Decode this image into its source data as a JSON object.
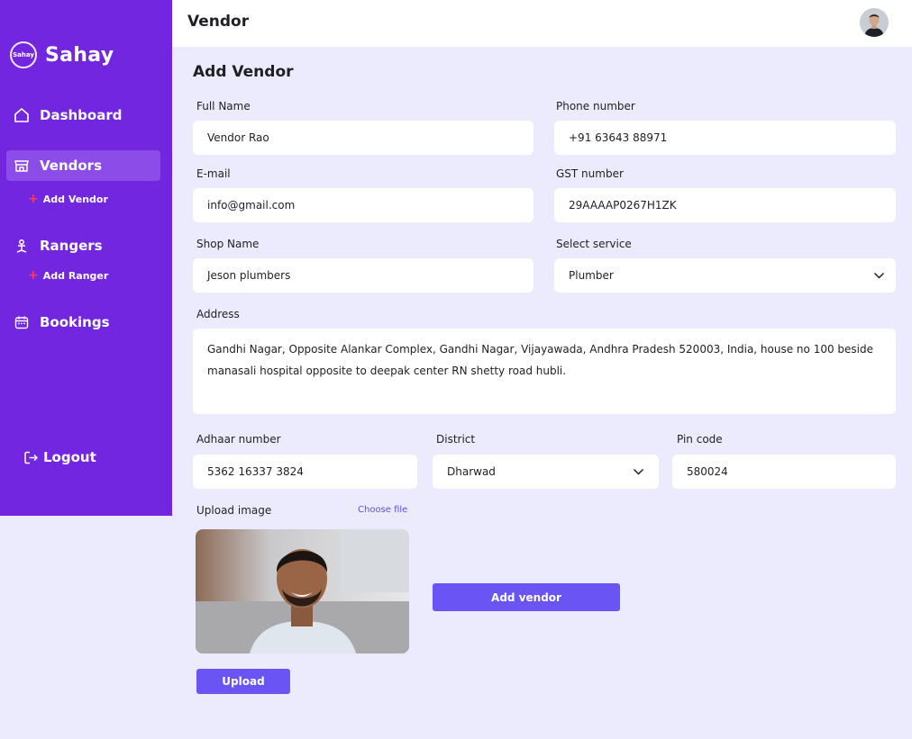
{
  "app": {
    "logo_badge": "Sahay",
    "name": "Sahay"
  },
  "sidebar": {
    "items": [
      {
        "label": "Dashboard",
        "icon": "home-icon"
      },
      {
        "label": "Vendors",
        "icon": "store-icon"
      },
      {
        "label": "Rangers",
        "icon": "ranger-icon"
      },
      {
        "label": "Bookings",
        "icon": "calendar-icon"
      }
    ],
    "sub_vendors": "Add Vendor",
    "sub_rangers": "Add Ranger",
    "logout": "Logout"
  },
  "header": {
    "title": "Vendor"
  },
  "form": {
    "title": "Add Vendor",
    "full_name": {
      "label": "Full Name",
      "value": "Vendor Rao"
    },
    "phone": {
      "label": "Phone number",
      "value": "+91 63643 88971"
    },
    "email": {
      "label": "E-mail",
      "value": "info@gmail.com"
    },
    "gst": {
      "label": "GST number",
      "value": "29AAAAP0267H1ZK"
    },
    "shop": {
      "label": "Shop Name",
      "value": "Jeson plumbers"
    },
    "service": {
      "label": "Select service",
      "value": "Plumber"
    },
    "address": {
      "label": "Address",
      "value": "Gandhi Nagar, Opposite Alankar Complex, Gandhi Nagar, Vijayawada, Andhra Pradesh 520003, India, house no 100 beside manasali hospital opposite to deepak center RN shetty road hubli."
    },
    "aadhaar": {
      "label": "Adhaar number",
      "value": "5362 16337 3824"
    },
    "district": {
      "label": "District",
      "value": "Dharwad"
    },
    "pincode": {
      "label": "Pin code",
      "value": "580024"
    },
    "upload": {
      "label": "Upload image",
      "choose": "Choose file",
      "button": "Upload"
    },
    "submit": "Add vendor"
  },
  "colors": {
    "sidebar": "#7326E0",
    "accent": "#6A55F4",
    "background": "#ECEBFD"
  }
}
